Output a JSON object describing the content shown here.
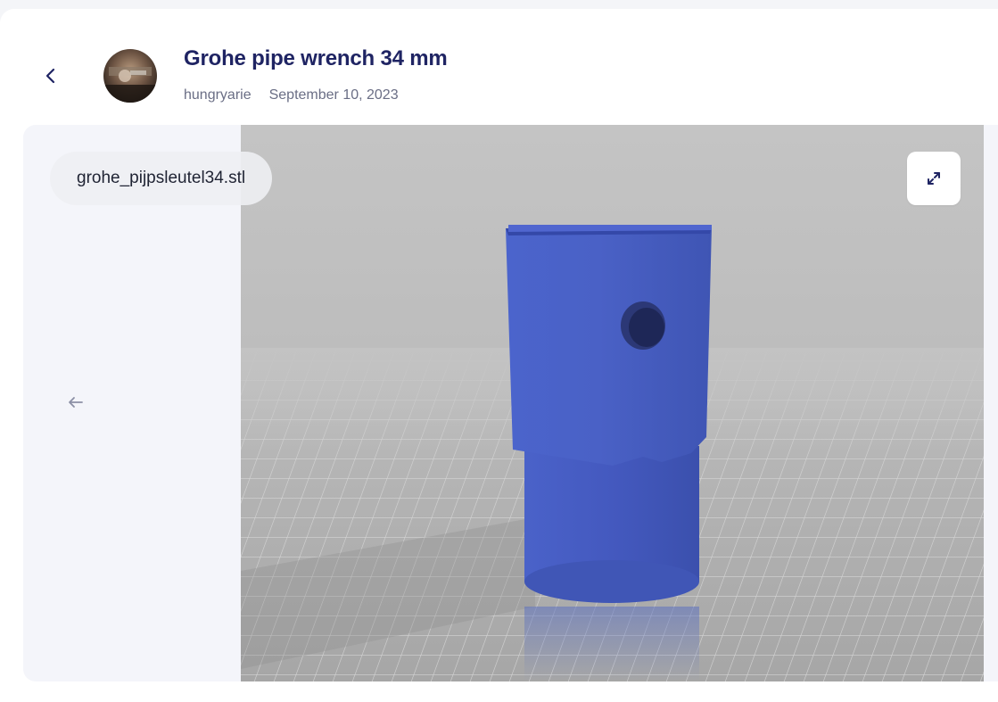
{
  "header": {
    "title": "Grohe pipe wrench 34 mm",
    "author": "hungryarie",
    "date": "September 10, 2023"
  },
  "viewer": {
    "file_name": "grohe_pijpsleutel34.stl"
  },
  "icons": {
    "back": "chevron-left-icon",
    "expand": "expand-icon",
    "prev": "arrow-left-icon"
  },
  "colors": {
    "title": "#1f2463",
    "model": "#4a60c8",
    "floor": "#b8b8b8"
  }
}
